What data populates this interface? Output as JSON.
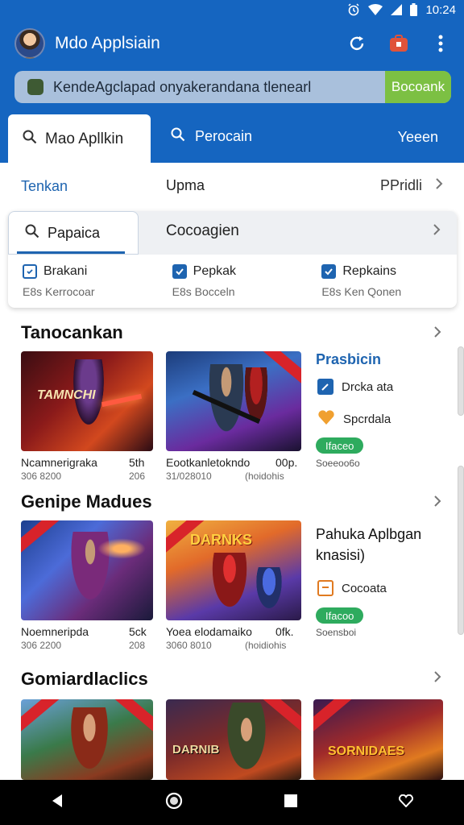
{
  "status_bar": {
    "time": "10:24"
  },
  "app_bar": {
    "title": "Mdo Applsiain"
  },
  "search": {
    "text": "KendeAgclapad onyakerandana tlenearl",
    "button": "Bocoank"
  },
  "tabs": {
    "active": "Mao Apllkin",
    "second": "Perocain",
    "third": "Yeeen"
  },
  "filter_row": {
    "left": "Tenkan",
    "middle": "Upma",
    "right": "PPridli"
  },
  "filter_card": {
    "search_label": "Papaica",
    "right_label": "Cocoagien",
    "columns": [
      {
        "label": "Brakani",
        "sub": "E8s Kerrocoar"
      },
      {
        "label": "Pepkak",
        "sub": "E8s Bocceln"
      },
      {
        "label": "Repkains",
        "sub": "E8s Ken Qonen"
      }
    ]
  },
  "section1": {
    "title": "Tanocankan",
    "tiles": [
      {
        "banner": "TAMNCHI",
        "caption": "Ncamnerigraka",
        "rating": "5th",
        "sub": "306 8200",
        "sub2": "206"
      },
      {
        "caption": "Eootkanletokndo",
        "rating": "00p.",
        "sub": "31/028010",
        "sub2": "(hoidohis"
      }
    ],
    "side": {
      "title": "Prasbicin",
      "items": [
        "Drcka ata",
        "Spcrdala"
      ],
      "pill": "Ifaceo",
      "sub": "Soeeoo6o"
    }
  },
  "section2": {
    "title": "Genipe Madues",
    "tiles": [
      {
        "caption": "Noemneripda",
        "rating": "5ck",
        "sub": "306 2200",
        "sub2": "208"
      },
      {
        "banner": "DARNKS",
        "caption": "Yoea elodamaiko",
        "rating": "0fk.",
        "sub": "3060 8010",
        "sub2": "(hoidiohis"
      }
    ],
    "side": {
      "title_line1": "Pahuka Aplbgan",
      "title_line2": "knasisi)",
      "item": "Cocoata",
      "pill": "Ifacoo",
      "sub": "Soensboi"
    }
  },
  "section3": {
    "title": "Gomiardlaclics",
    "tiles": [
      {},
      {
        "banner": "DARNIB"
      },
      {
        "banner": "SORNIDAES"
      }
    ]
  },
  "colors": {
    "primary": "#1565c0",
    "accent_green": "#7cc043",
    "pill_green": "#2eab5e",
    "link_blue": "#1e64b0"
  },
  "icons": [
    "alarm-icon",
    "wifi-icon",
    "signal-icon",
    "battery-icon",
    "refresh-icon",
    "store-badge-icon",
    "more-vert-icon",
    "search-icon",
    "chevron-right-icon",
    "back-icon",
    "home-icon",
    "recents-icon",
    "heart-icon"
  ]
}
